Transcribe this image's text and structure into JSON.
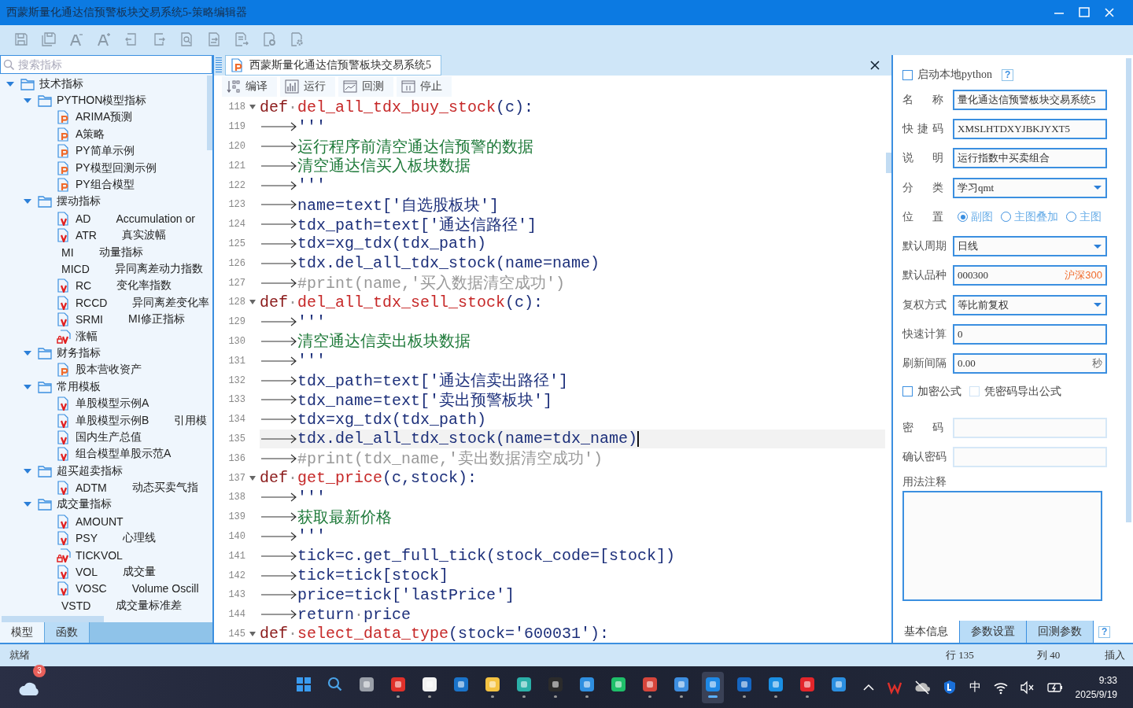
{
  "window": {
    "title": "西蒙斯量化通达信预警板块交易系统5-策略编辑器"
  },
  "sidebar": {
    "search": {
      "placeholder": "搜索指标"
    },
    "tree": [
      {
        "kind": "folder",
        "label": "技术指标",
        "expanded": true,
        "children": [
          {
            "kind": "folder",
            "label": "PYTHON模型指标",
            "expanded": true,
            "children": [
              {
                "kind": "py",
                "label": "ARIMA预测"
              },
              {
                "kind": "py",
                "label": "A策略"
              },
              {
                "kind": "py",
                "label": "PY简单示例"
              },
              {
                "kind": "py",
                "label": "PY模型回测示例"
              },
              {
                "kind": "py",
                "label": "PY组合模型"
              }
            ]
          },
          {
            "kind": "folder",
            "label": "摆动指标",
            "expanded": true,
            "children": [
              {
                "kind": "v",
                "label": "AD",
                "desc": "Accumulation or"
              },
              {
                "kind": "v",
                "label": "ATR",
                "desc": "真实波幅"
              },
              {
                "kind": "plain",
                "label": "MI",
                "desc": "动量指标"
              },
              {
                "kind": "plain",
                "label": "MICD",
                "desc": "异同离差动力指数"
              },
              {
                "kind": "v",
                "label": "RC",
                "desc": "变化率指数"
              },
              {
                "kind": "v",
                "label": "RCCD",
                "desc": "异同离差变化率"
              },
              {
                "kind": "v",
                "label": "SRMI",
                "desc": "MI修正指标"
              },
              {
                "kind": "vlock",
                "label": "涨幅"
              }
            ]
          },
          {
            "kind": "folder",
            "label": "财务指标",
            "expanded": true,
            "children": [
              {
                "kind": "py",
                "label": "股本营收资产"
              }
            ]
          },
          {
            "kind": "folder",
            "label": "常用模板",
            "expanded": true,
            "children": [
              {
                "kind": "v",
                "label": "单股模型示例A"
              },
              {
                "kind": "v",
                "label": "单股模型示例B",
                "desc": "引用模"
              },
              {
                "kind": "v",
                "label": "国内生产总值"
              },
              {
                "kind": "v",
                "label": "组合模型单股示范A"
              }
            ]
          },
          {
            "kind": "folder",
            "label": "超买超卖指标",
            "expanded": true,
            "children": [
              {
                "kind": "v",
                "label": "ADTM",
                "desc": "动态买卖气指"
              }
            ]
          },
          {
            "kind": "folder",
            "label": "成交量指标",
            "expanded": true,
            "children": [
              {
                "kind": "v",
                "label": "AMOUNT"
              },
              {
                "kind": "v",
                "label": "PSY",
                "desc": "心理线"
              },
              {
                "kind": "vlock",
                "label": "TICKVOL"
              },
              {
                "kind": "v",
                "label": "VOL",
                "desc": "成交量"
              },
              {
                "kind": "v",
                "label": "VOSC",
                "desc": "Volume Oscill"
              },
              {
                "kind": "plain",
                "label": "VSTD",
                "desc": "成交量标准差"
              }
            ]
          }
        ]
      }
    ],
    "tabs": [
      {
        "label": "模型",
        "selected": true
      },
      {
        "label": "函数",
        "selected": false
      }
    ]
  },
  "editor": {
    "tab": {
      "label": "西蒙斯量化通达信预警板块交易系统5"
    },
    "toolbar": [
      {
        "kind": "compile",
        "label": "编译"
      },
      {
        "kind": "run",
        "label": "运行"
      },
      {
        "kind": "backtest",
        "label": "回测"
      },
      {
        "kind": "stop",
        "label": "停止"
      }
    ],
    "lines": [
      {
        "no": "118",
        "fold": true,
        "tab": false,
        "current": false,
        "segments": [
          {
            "kind": "kw",
            "t": "def"
          },
          {
            "kind": "ws",
            "t": "·"
          },
          {
            "kind": "fn",
            "t": "del_all_tdx_buy_stock"
          },
          {
            "kind": "code",
            "t": "(c):"
          }
        ]
      },
      {
        "no": "119",
        "fold": false,
        "tab": true,
        "current": false,
        "segments": [
          {
            "kind": "code",
            "t": "'''"
          }
        ]
      },
      {
        "no": "120",
        "fold": false,
        "tab": true,
        "current": false,
        "segments": [
          {
            "kind": "doc",
            "t": "运行程序前清空通达信预警的数据"
          }
        ]
      },
      {
        "no": "121",
        "fold": false,
        "tab": true,
        "current": false,
        "segments": [
          {
            "kind": "doc",
            "t": "清空通达信买入板块数据"
          }
        ]
      },
      {
        "no": "122",
        "fold": false,
        "tab": true,
        "current": false,
        "segments": [
          {
            "kind": "code",
            "t": "'''"
          }
        ]
      },
      {
        "no": "123",
        "fold": false,
        "tab": true,
        "current": false,
        "segments": [
          {
            "kind": "code",
            "t": "name=text['自选股板块']"
          }
        ]
      },
      {
        "no": "124",
        "fold": false,
        "tab": true,
        "current": false,
        "segments": [
          {
            "kind": "code",
            "t": "tdx_path=text['通达信路径']"
          }
        ]
      },
      {
        "no": "125",
        "fold": false,
        "tab": true,
        "current": false,
        "segments": [
          {
            "kind": "code",
            "t": "tdx=xg_tdx(tdx_path)"
          }
        ]
      },
      {
        "no": "126",
        "fold": false,
        "tab": true,
        "current": false,
        "segments": [
          {
            "kind": "code",
            "t": "tdx.del_all_tdx_stock(name=name)"
          }
        ]
      },
      {
        "no": "127",
        "fold": false,
        "tab": true,
        "current": false,
        "segments": [
          {
            "kind": "cmt",
            "t": "#print(name,'买入数据清空成功')"
          }
        ]
      },
      {
        "no": "128",
        "fold": true,
        "tab": false,
        "current": false,
        "segments": [
          {
            "kind": "kw",
            "t": "def"
          },
          {
            "kind": "ws",
            "t": "·"
          },
          {
            "kind": "fn",
            "t": "del_all_tdx_sell_stock"
          },
          {
            "kind": "code",
            "t": "(c):"
          }
        ]
      },
      {
        "no": "129",
        "fold": false,
        "tab": true,
        "current": false,
        "segments": [
          {
            "kind": "code",
            "t": "'''"
          }
        ]
      },
      {
        "no": "130",
        "fold": false,
        "tab": true,
        "current": false,
        "segments": [
          {
            "kind": "doc",
            "t": "清空通达信卖出板块数据"
          }
        ]
      },
      {
        "no": "131",
        "fold": false,
        "tab": true,
        "current": false,
        "segments": [
          {
            "kind": "code",
            "t": "'''"
          }
        ]
      },
      {
        "no": "132",
        "fold": false,
        "tab": true,
        "current": false,
        "segments": [
          {
            "kind": "code",
            "t": "tdx_path=text['通达信卖出路径']"
          }
        ]
      },
      {
        "no": "133",
        "fold": false,
        "tab": true,
        "current": false,
        "segments": [
          {
            "kind": "code",
            "t": "tdx_name=text['卖出预警板块']"
          }
        ]
      },
      {
        "no": "134",
        "fold": false,
        "tab": true,
        "current": false,
        "segments": [
          {
            "kind": "code",
            "t": "tdx=xg_tdx(tdx_path)"
          }
        ]
      },
      {
        "no": "135",
        "fold": false,
        "tab": true,
        "current": true,
        "segments": [
          {
            "kind": "code",
            "t": "tdx.del_all_tdx_stock(name=tdx_name)"
          }
        ]
      },
      {
        "no": "136",
        "fold": false,
        "tab": true,
        "current": false,
        "segments": [
          {
            "kind": "cmt",
            "t": "#print(tdx_name,'卖出数据清空成功')"
          }
        ]
      },
      {
        "no": "137",
        "fold": true,
        "tab": false,
        "current": false,
        "segments": [
          {
            "kind": "kw",
            "t": "def"
          },
          {
            "kind": "ws",
            "t": "·"
          },
          {
            "kind": "fn",
            "t": "get_price"
          },
          {
            "kind": "code",
            "t": "(c,stock):"
          }
        ]
      },
      {
        "no": "138",
        "fold": false,
        "tab": true,
        "current": false,
        "segments": [
          {
            "kind": "code",
            "t": "'''"
          }
        ]
      },
      {
        "no": "139",
        "fold": false,
        "tab": true,
        "current": false,
        "segments": [
          {
            "kind": "doc",
            "t": "获取最新价格"
          }
        ]
      },
      {
        "no": "140",
        "fold": false,
        "tab": true,
        "current": false,
        "segments": [
          {
            "kind": "code",
            "t": "'''"
          }
        ]
      },
      {
        "no": "141",
        "fold": false,
        "tab": true,
        "current": false,
        "segments": [
          {
            "kind": "code",
            "t": "tick=c.get_full_tick(stock_code=[stock])"
          }
        ]
      },
      {
        "no": "142",
        "fold": false,
        "tab": true,
        "current": false,
        "segments": [
          {
            "kind": "code",
            "t": "tick=tick[stock]"
          }
        ]
      },
      {
        "no": "143",
        "fold": false,
        "tab": true,
        "current": false,
        "segments": [
          {
            "kind": "code",
            "t": "price=tick['lastPrice']"
          }
        ]
      },
      {
        "no": "144",
        "fold": false,
        "tab": true,
        "current": false,
        "segments": [
          {
            "kind": "code",
            "t": "return"
          },
          {
            "kind": "ws",
            "t": "·"
          },
          {
            "kind": "code",
            "t": "price"
          }
        ]
      },
      {
        "no": "145",
        "fold": true,
        "tab": false,
        "current": false,
        "segments": [
          {
            "kind": "kw",
            "t": "def"
          },
          {
            "kind": "ws",
            "t": "·"
          },
          {
            "kind": "fn",
            "t": "select_data_type"
          },
          {
            "kind": "code",
            "t": "(stock='600031'):"
          }
        ]
      }
    ]
  },
  "settings": {
    "local_python": {
      "label": "启动本地python",
      "checked": false,
      "help": "?"
    },
    "fields": [
      {
        "kind": "text",
        "label": "名称",
        "value": "量化通达信预警板块交易系统5"
      },
      {
        "kind": "text",
        "label": "快捷码",
        "value": "XMSLHTDXYJBKJYXT5"
      },
      {
        "kind": "text",
        "label": "说明",
        "value": "运行指数中买卖组合"
      },
      {
        "kind": "select",
        "label": "分类",
        "value": "学习qmt"
      },
      {
        "kind": "radio",
        "label": "位置",
        "options": [
          {
            "label": "副图",
            "selected": true
          },
          {
            "label": "主图叠加",
            "selected": false
          },
          {
            "label": "主图",
            "selected": false
          }
        ]
      },
      {
        "kind": "select",
        "label": "默认周期",
        "value": "日线"
      },
      {
        "kind": "text",
        "label": "默认品种",
        "value": "000300",
        "suffix": "沪深300",
        "suffix_highlight": true
      },
      {
        "kind": "select",
        "label": "复权方式",
        "value": "等比前复权"
      },
      {
        "kind": "text",
        "label": "快速计算",
        "value": "0"
      },
      {
        "kind": "text",
        "label": "刷新间隔",
        "value": "0.00",
        "suffix": "秒",
        "suffix_highlight": false
      }
    ],
    "checkboxes": [
      {
        "label": "加密公式",
        "checked": false,
        "disabled": false
      },
      {
        "label": "凭密码导出公式",
        "checked": false,
        "disabled": true
      }
    ],
    "password_fields": [
      {
        "label": "密码",
        "disabled": true
      },
      {
        "label": "确认密码",
        "disabled": true
      }
    ],
    "notes_label": "用法注释",
    "tabs": [
      {
        "label": "基本信息",
        "selected": true
      },
      {
        "label": "参数设置",
        "selected": false
      },
      {
        "label": "回测参数",
        "selected": false
      }
    ],
    "help": "?"
  },
  "status_bar": {
    "message": "就绪",
    "line": "行 135",
    "column": "列 40",
    "mode": "插入"
  },
  "taskbar": {
    "weather_badge": "3",
    "apps": [
      {
        "kind": "start",
        "color": "#3a9bf0",
        "open": false,
        "selected": false
      },
      {
        "kind": "search",
        "color": "#4aa3e8",
        "open": false,
        "selected": false
      },
      {
        "kind": "app",
        "color": "#9a9fa8",
        "open": false,
        "selected": false
      },
      {
        "kind": "app",
        "color": "#e0312b",
        "open": true,
        "selected": false
      },
      {
        "kind": "app",
        "color": "#f2f2f2",
        "open": true,
        "selected": false
      },
      {
        "kind": "app",
        "color": "#1a73c9",
        "open": false,
        "selected": false
      },
      {
        "kind": "app",
        "color": "#f5c342",
        "open": true,
        "selected": false
      },
      {
        "kind": "app",
        "color": "#2bb0a8",
        "open": true,
        "selected": false
      },
      {
        "kind": "app",
        "color": "#2b2b2b",
        "open": true,
        "selected": false
      },
      {
        "kind": "app",
        "color": "#2f8fe0",
        "open": true,
        "selected": false
      },
      {
        "kind": "app",
        "color": "#1fbf6a",
        "open": false,
        "selected": false
      },
      {
        "kind": "app",
        "color": "#d6463c",
        "open": true,
        "selected": false
      },
      {
        "kind": "app",
        "color": "#3d8ee0",
        "open": true,
        "selected": false
      },
      {
        "kind": "app",
        "color": "#1e88e5",
        "open": true,
        "selected": true
      },
      {
        "kind": "app",
        "color": "#1565c0",
        "open": true,
        "selected": false
      },
      {
        "kind": "app",
        "color": "#1a8fe3",
        "open": true,
        "selected": false
      },
      {
        "kind": "app",
        "color": "#e3262b",
        "open": true,
        "selected": false
      },
      {
        "kind": "app",
        "color": "#2b8fe0",
        "open": false,
        "selected": false
      }
    ],
    "input_method": "中",
    "time": "9:33",
    "date": "2025/9/19"
  }
}
